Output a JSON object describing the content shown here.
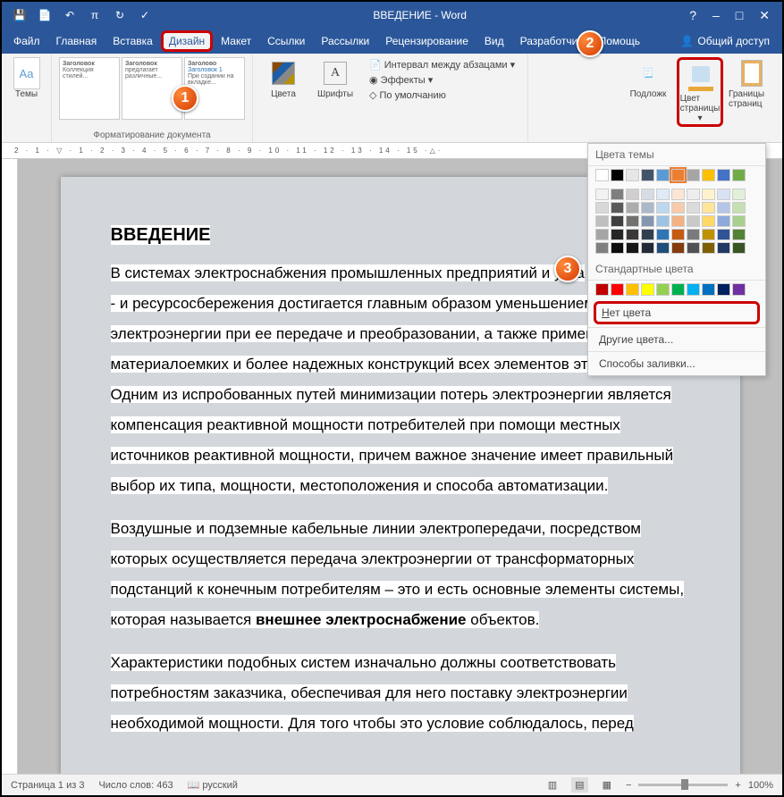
{
  "title": "ВВЕДЕНИЕ - Word",
  "qat": {
    "save": "💾",
    "touch": "📄",
    "undo": "↶",
    "pi": "π",
    "redo": "↻",
    "tick": "✓"
  },
  "winctl": {
    "help": "?",
    "min": "–",
    "max": "□",
    "close": "✕"
  },
  "menu": {
    "file": "Файл",
    "home": "Главная",
    "insert": "Вставка",
    "design": "Дизайн",
    "layout": "Макет",
    "refs": "Ссылки",
    "mail": "Рассылки",
    "review": "Рецензирование",
    "view": "Вид",
    "dev": "Разработчик",
    "help": "Помощь",
    "share": "Общий доступ"
  },
  "ribbon": {
    "themes": "Темы",
    "themes_aa": "Aa",
    "g1": "Заголовок",
    "g1b": "Коллекция стилей...",
    "g2": "Заголовок",
    "g2b": "предлагает различные...",
    "g3": "Заголово",
    "g3sub": "Заголовок 1",
    "g3b": "При содании на вкладке...",
    "colors": "Цвета",
    "fonts": "Шрифты",
    "fonts_a": "A",
    "spacing": "Интервал между абзацами ▾",
    "effects": "Эффекты ▾",
    "default": "По умолчанию",
    "watermark": "Подложк",
    "pagecolor": "Цвет страницы",
    "pagecolor_dd": "▾",
    "borders": "Границы страниц",
    "grouplabel": "Форматирование документа"
  },
  "doc": {
    "h1": "ВВЕДЕНИЕ",
    "p1": "В системах электроснабжения промышленных предприятий и уста",
    "p1b": "- и ресурсосбережения достигается главным образом уменьшением",
    "p1c": "электроэнергии при ее передаче и преобразовании, а также применение менее",
    "p1d": "материалоемких и более надежных конструкций всех элементов этой системы.",
    "p1e": "Одним из испробованных путей минимизации потерь электроэнергии является",
    "p1f": "компенсация реактивной мощности потребителей при помощи местных",
    "p1g": "источников реактивной мощности, причем важное значение имеет правильный",
    "p1h": "выбор их типа, мощности, местоположения и способа автоматизации.",
    "p2a": "Воздушные и подземные кабельные линии электропередачи, посредством",
    "p2b": "которых осуществляется передача электроэнергии от трансформаторных",
    "p2c": "подстанций к конечным потребителям – это и есть основные элементы системы,",
    "p2d1": "которая называется ",
    "p2d2": "внешнее электроснабжение",
    "p2d3": " объектов.",
    "p3a": "Характеристики подобных систем изначально должны соответствовать",
    "p3b": "потребностям заказчика, обеспечивая для него поставку электроэнергии",
    "p3c": "необходимой мощности. Для того чтобы это условие соблюдалось, перед"
  },
  "colormenu": {
    "theme": "Цвета темы",
    "std": "Стандартные цвета",
    "none": "Нет цвета",
    "more": "Другие цвета...",
    "fill": "Способы заливки...",
    "theme_row1": [
      "#fff",
      "#000",
      "#e7e6e6",
      "#44546a",
      "#5b9bd5",
      "#ed7d31",
      "#a5a5a5",
      "#ffc000",
      "#4472c4",
      "#70ad47"
    ],
    "theme_row2": [
      "#f2f2f2",
      "#7f7f7f",
      "#d0cece",
      "#d6dce4",
      "#deebf6",
      "#fbe5d5",
      "#ededed",
      "#fff2cc",
      "#d9e2f3",
      "#e2efd9"
    ],
    "theme_row3": [
      "#d8d8d8",
      "#595959",
      "#aeabab",
      "#adb9ca",
      "#bdd7ee",
      "#f7cbac",
      "#dbdbdb",
      "#fee599",
      "#b4c6e7",
      "#c5e0b3"
    ],
    "theme_row4": [
      "#bfbfbf",
      "#3f3f3f",
      "#757070",
      "#8496b0",
      "#9cc3e5",
      "#f4b183",
      "#c9c9c9",
      "#ffd965",
      "#8eaadb",
      "#a8d08d"
    ],
    "theme_row5": [
      "#a5a5a5",
      "#262626",
      "#3a3838",
      "#323f4f",
      "#2e75b5",
      "#c55a11",
      "#7b7b7b",
      "#bf9000",
      "#2f5496",
      "#538135"
    ],
    "theme_row6": [
      "#7f7f7f",
      "#0c0c0c",
      "#171616",
      "#222a35",
      "#1e4e79",
      "#833c0b",
      "#525252",
      "#7f6000",
      "#1f3864",
      "#375623"
    ],
    "std_row": [
      "#c00000",
      "#ff0000",
      "#ffc000",
      "#ffff00",
      "#92d050",
      "#00b050",
      "#00b0f0",
      "#0070c0",
      "#002060",
      "#7030a0"
    ],
    "current": "#ed7d31"
  },
  "status": {
    "page": "Страница 1 из 3",
    "words": "Число слов: 463",
    "lang": "русский",
    "zoom": "100%"
  },
  "badges": {
    "b1": "1",
    "b2": "2",
    "b3": "3"
  }
}
